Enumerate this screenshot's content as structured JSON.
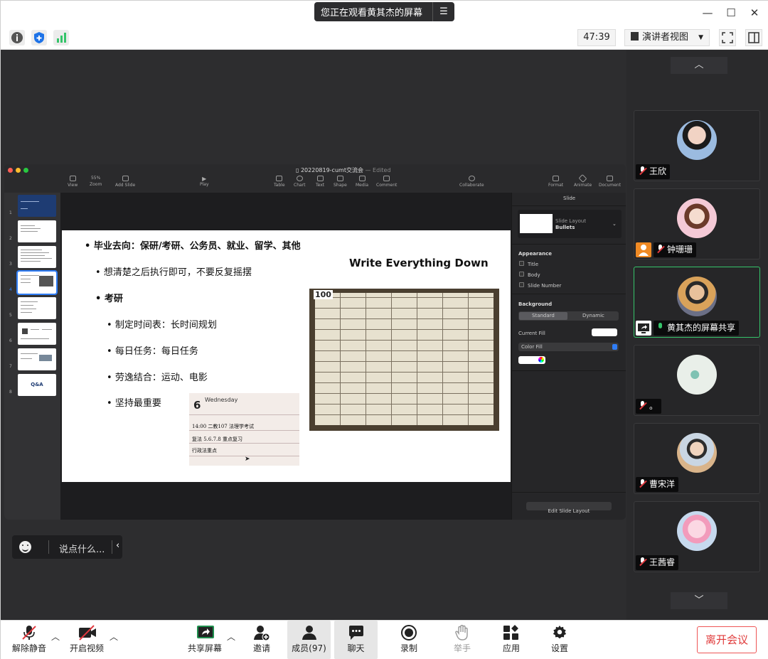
{
  "window": {
    "share_banner": "您正在观看黄其杰的屏幕",
    "share_menu_icon": "menu-lines-icon",
    "controls": [
      "minimize-icon",
      "maximize-icon",
      "close-icon"
    ]
  },
  "toolbar": {
    "timer": "47:39",
    "view_mode": "演讲者视图",
    "icons": [
      "info-icon",
      "shield-icon",
      "signal-icon",
      "fullscreen-icon",
      "sidebar-toggle-icon"
    ]
  },
  "keynote": {
    "file_title": "20220819-cumt交流会",
    "edited": "— Edited",
    "tools": {
      "view": "View",
      "zoom_value": "55%",
      "zoom": "Zoom",
      "add_slide": "Add Slide",
      "play": "Play",
      "table": "Table",
      "chart": "Chart",
      "text": "Text",
      "shape": "Shape",
      "media": "Media",
      "comment": "Comment",
      "collaborate": "Collaborate",
      "format": "Format",
      "animate": "Animate",
      "document": "Document"
    },
    "thumbnails": [
      "1",
      "2",
      "3",
      "4",
      "5",
      "6",
      "7",
      "8"
    ],
    "thumb_qa": "Q&A",
    "inspector": {
      "tab": "Slide",
      "layout_label": "Slide Layout",
      "layout_value": "Bullets",
      "appearance": "Appearance",
      "opt_title": "Title",
      "opt_body": "Body",
      "opt_slide_number": "Slide Number",
      "background": "Background",
      "seg_standard": "Standard",
      "seg_dynamic": "Dynamic",
      "current_fill": "Current Fill",
      "color_fill": "Color Fill",
      "edit_layout": "Edit Slide Layout"
    }
  },
  "slide": {
    "bullet_1": "毕业去向：保研/考研、公务员、就业、留学、其他",
    "bullet_2": "想清楚之后执行即可，不要反复摇摆",
    "bullet_3": "考研",
    "bullet_4": "制定时间表：长时间规划",
    "bullet_5": "每日任务：每日任务",
    "bullet_6": "劳逸结合：运动、电影",
    "bullet_7": "坚持最重要",
    "heading": "Write Everything Down",
    "calendar_number": "100",
    "notebook": {
      "day": "6",
      "weekday": "Wednesday",
      "line_1": "14:00  二教107  法理学考试",
      "line_2": "复法 5.6.7.8 重点复习",
      "line_3": "行政法重点"
    }
  },
  "chat": {
    "placeholder": "说点什么..."
  },
  "participants": [
    {
      "name": "王欣",
      "mic": "muted"
    },
    {
      "name": "钟珊珊",
      "mic": "muted"
    },
    {
      "name": "黄其杰的屏幕共享",
      "mic": "on",
      "sharing": true
    },
    {
      "name": "。",
      "mic": "muted"
    },
    {
      "name": "曹宋洋",
      "mic": "muted"
    },
    {
      "name": "王茜睿",
      "mic": "muted"
    }
  ],
  "bottombar": {
    "unmute": "解除静音",
    "start_video": "开启视频",
    "share_screen": "共享屏幕",
    "invite": "邀请",
    "members": "成员(97)",
    "chat": "聊天",
    "record": "录制",
    "raise_hand": "举手",
    "apps": "应用",
    "settings": "设置",
    "leave": "离开会议"
  },
  "colors": {
    "accent_green": "#35c46a",
    "leave_red": "#e03a3a",
    "muted_red": "#e0383e",
    "stage_bg": "#2d2d2f"
  }
}
